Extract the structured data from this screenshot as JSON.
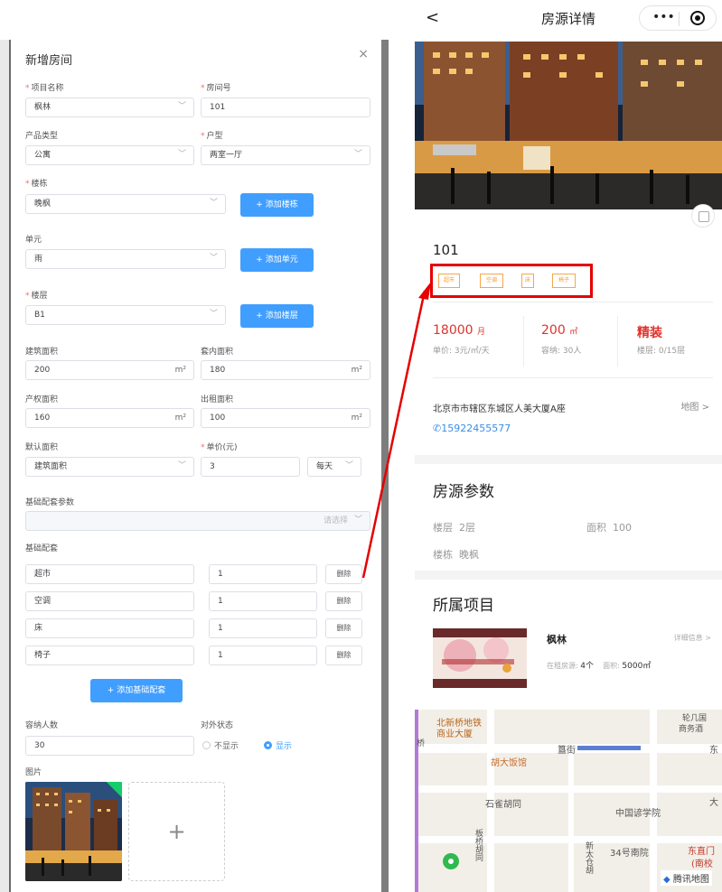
{
  "dialog": {
    "title": "新增房间",
    "close": "×",
    "fields": {
      "project_label": "项目名称",
      "project_value": "枫林",
      "room_no_label": "房间号",
      "room_no_value": "101",
      "product_type_label": "产品类型",
      "product_type_value": "公寓",
      "layout_label": "户型",
      "layout_value": "两室一厅",
      "building_label": "楼栋",
      "building_value": "晚枫",
      "add_building": "+ 添加楼栋",
      "unit_label": "单元",
      "unit_value": "雨",
      "add_unit": "+ 添加单元",
      "floor_label": "楼层",
      "floor_value": "B1",
      "add_floor": "+ 添加楼层",
      "build_area_label": "建筑面积",
      "build_area_value": "200",
      "area_unit": "m²",
      "inner_area_label": "套内面积",
      "inner_area_value": "180",
      "title_area_label": "产权面积",
      "title_area_value": "160",
      "rent_area_label": "出租面积",
      "rent_area_value": "100",
      "default_area_label": "默认面积",
      "default_area_value": "建筑面积",
      "unit_price_label": "单价(元)",
      "unit_price_value": "3",
      "price_period": "每天",
      "facility_params_label": "基础配套参数",
      "facility_params_placeholder": "请选择",
      "facility_label": "基础配套",
      "capacity_label": "容纳人数",
      "capacity_value": "30",
      "visibility_label": "对外状态",
      "visibility_hidden": "不显示",
      "visibility_shown": "显示",
      "image_label": "图片"
    },
    "facilities": [
      {
        "name": "超市",
        "qty": "1",
        "delete": "删除"
      },
      {
        "name": "空调",
        "qty": "1",
        "delete": "删除"
      },
      {
        "name": "床",
        "qty": "1",
        "delete": "删除"
      },
      {
        "name": "椅子",
        "qty": "1",
        "delete": "删除"
      }
    ],
    "add_facility": "+ 添加基础配套",
    "add_image": "+"
  },
  "phone": {
    "back": "<",
    "title": "房源详情",
    "more": "•••",
    "room_no": "101",
    "tags": [
      "超市",
      "空调",
      "床",
      "椅子"
    ],
    "stats": {
      "price_value": "18000",
      "price_unit": "月",
      "price_sub": "单价: 3元/㎡/天",
      "area_value": "200",
      "area_unit": "㎡",
      "area_sub": "容纳: 30人",
      "deco_value": "精装",
      "deco_sub": "楼层: 0/15层"
    },
    "address": "北京市市辖区东城区人美大厦A座",
    "map_link": "地图 >",
    "phone_number": "15922455577",
    "params_title": "房源参数",
    "params": {
      "floor_label": "楼层",
      "floor_value": "2层",
      "area_label": "面积",
      "area_value": "100",
      "building_label": "楼栋",
      "building_value": "晚枫"
    },
    "project_title": "所属项目",
    "project": {
      "name": "枫林",
      "detail": "详细信息 >",
      "listing_label": "在租房源:",
      "listing_value": "4个",
      "area_label": "面积:",
      "area_value": "5000㎡"
    },
    "map_labels": [
      "北新桥地铁",
      "商业大厦",
      "胡大饭馆",
      "簋街",
      "石雀胡同",
      "中国谚学院",
      "34号南院",
      "东直门",
      "(南校",
      "板桥胡同",
      "新太仓胡",
      "东",
      "大",
      "轮几国",
      "商务酒",
      "桥"
    ],
    "map_brand": "腾讯地图"
  },
  "colors": {
    "accent": "#409eff",
    "highlight": "#e60000",
    "tag": "#f39b32",
    "price": "#e0322c",
    "phone": "#3a8ee6"
  }
}
